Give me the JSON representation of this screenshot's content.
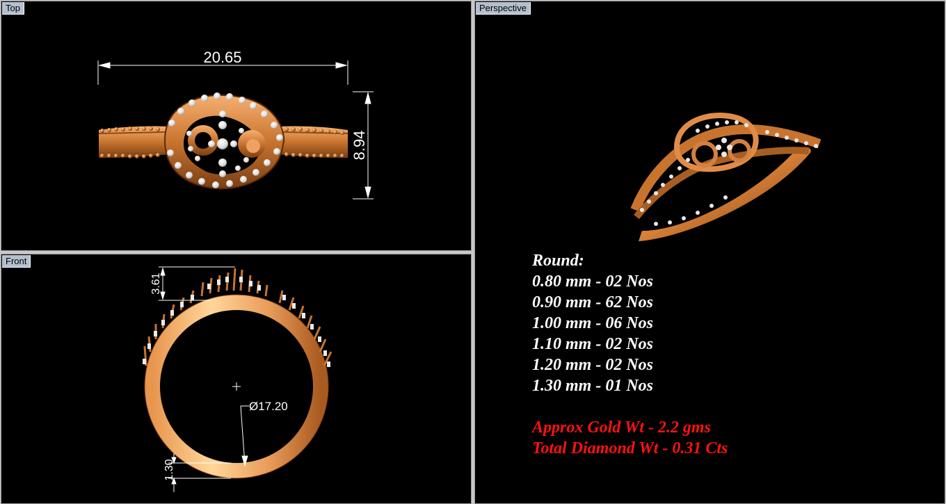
{
  "viewports": {
    "top": "Top",
    "front": "Front",
    "perspective": "Perspective"
  },
  "dimensions": {
    "width": "20.65",
    "height": "8.94",
    "top_height": "3.61",
    "diameter": "Ø17.20",
    "band": "1.30"
  },
  "specs": {
    "heading": "Round:",
    "rows": [
      "0.80 mm - 02 Nos",
      "0.90 mm - 62 Nos",
      "1.00 mm - 06 Nos",
      "1.10 mm - 02 Nos",
      "1.20 mm - 02 Nos",
      "1.30 mm - 01 Nos"
    ],
    "gold_weight": "Approx Gold Wt - 2.2 gms",
    "diamond_weight": "Total Diamond Wt - 0.31 Cts"
  },
  "colors": {
    "gold": "#c87a3a",
    "gold_light": "#f3a866",
    "diamond": "#e8e8e8",
    "highlight_red": "#ff1111",
    "label_bg": "#b4c0d0"
  }
}
